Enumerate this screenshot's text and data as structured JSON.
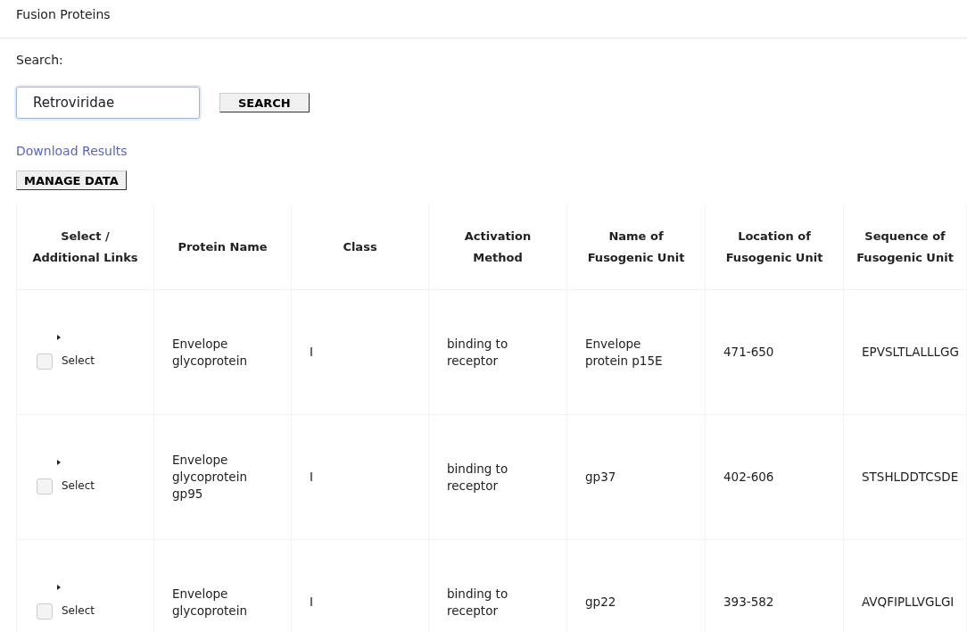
{
  "page": {
    "title": "Fusion Proteins"
  },
  "search": {
    "label": "Search:",
    "value": "Retroviridae",
    "button": "SEARCH"
  },
  "download_link": "Download Results",
  "manage_button": "MANAGE DATA",
  "table": {
    "columns": [
      "Select / Additional Links",
      "Protein Name",
      "Class",
      "Activation Method",
      "Name of Fusogenic Unit",
      "Location of Fusogenic Unit",
      "Sequence of Fusogenic Unit"
    ],
    "rows": [
      {
        "checked": false,
        "select_label": "Select",
        "protein_name": "Envelope glycoprotein",
        "class": "I",
        "activation_method": "binding to receptor",
        "unit_name": "Envelope protein p15E",
        "location": "471-650",
        "sequence": "EPVSLTLALLLGG"
      },
      {
        "checked": false,
        "select_label": "Select",
        "protein_name": "Envelope glycoprotein gp95",
        "class": "I",
        "activation_method": "binding to receptor",
        "unit_name": "gp37",
        "location": "402-606",
        "sequence": "STSHLDDTCSDE"
      },
      {
        "checked": false,
        "select_label": "Select",
        "protein_name": "Envelope glycoprotein",
        "class": "I",
        "activation_method": "binding to receptor",
        "unit_name": "gp22",
        "location": "393-582",
        "sequence": "AVQFIPLLVGLGI"
      }
    ]
  }
}
